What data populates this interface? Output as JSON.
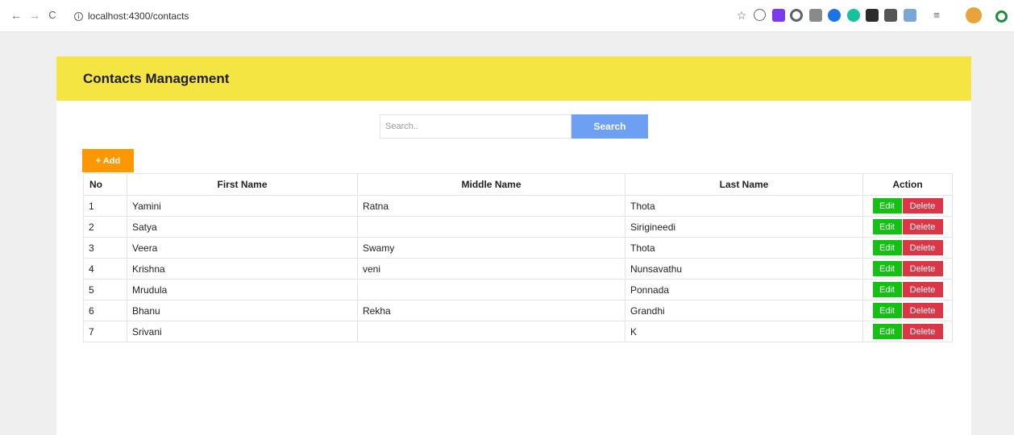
{
  "browser": {
    "back": "←",
    "forward": "→",
    "reload": "C",
    "info": "i",
    "url": "localhost:4300/contacts",
    "star": "☆"
  },
  "app": {
    "title": "Contacts Management",
    "search_placeholder": "Search..",
    "search_label": "Search",
    "add_label": "+ Add",
    "edit_label": "Edit",
    "delete_label": "Delete"
  },
  "table": {
    "headers": [
      "No",
      "First Name",
      "Middle Name",
      "Last Name",
      "Action"
    ],
    "rows": [
      {
        "no": "1",
        "first": "Yamini",
        "middle": "Ratna",
        "last": "Thota"
      },
      {
        "no": "2",
        "first": "Satya",
        "middle": "",
        "last": "Sirigineedi"
      },
      {
        "no": "3",
        "first": "Veera",
        "middle": "Swamy",
        "last": "Thota"
      },
      {
        "no": "4",
        "first": "Krishna",
        "middle": "veni",
        "last": "Nunsavathu"
      },
      {
        "no": "5",
        "first": "Mrudula",
        "middle": "",
        "last": "Ponnada"
      },
      {
        "no": "6",
        "first": "Bhanu",
        "middle": "Rekha",
        "last": "Grandhi"
      },
      {
        "no": "7",
        "first": "Srivani",
        "middle": "",
        "last": "K"
      }
    ]
  },
  "colors": {
    "header_bg": "#f4e542",
    "search_btn": "#6d9ff2",
    "add_btn": "#ff9800",
    "edit_btn": "#12c112",
    "delete_btn": "#dc3545"
  }
}
